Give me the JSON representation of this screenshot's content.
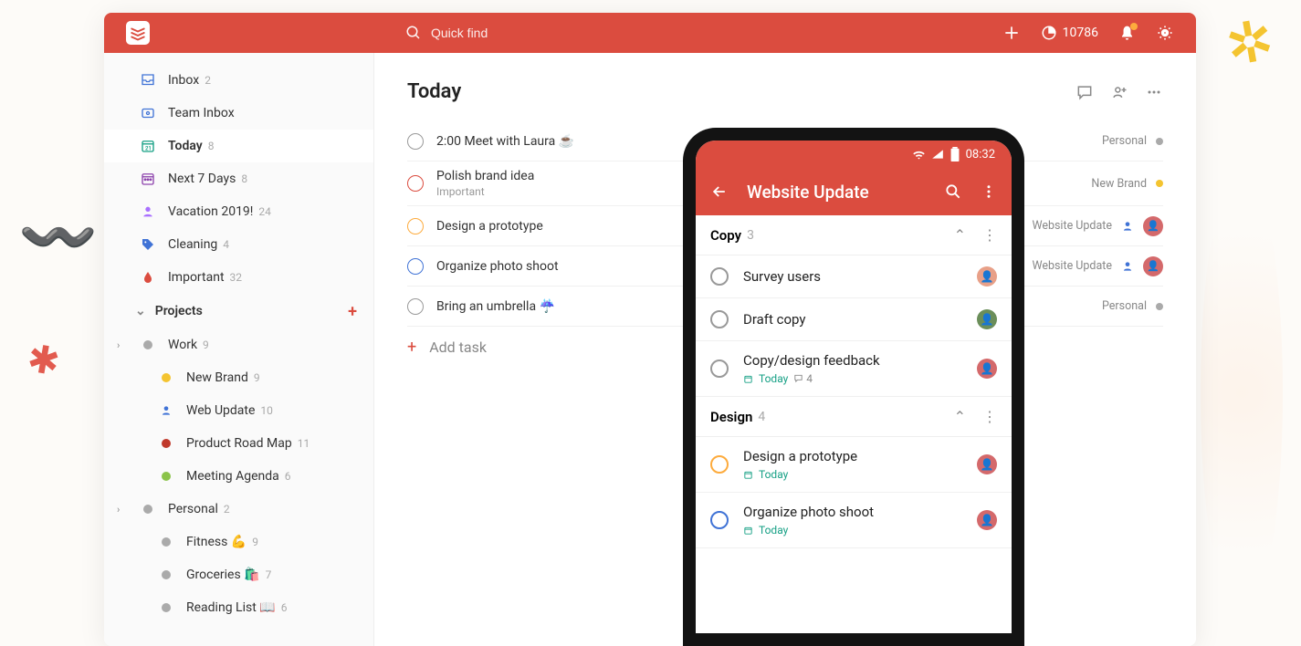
{
  "header": {
    "search_placeholder": "Quick find",
    "karma_count": "10786"
  },
  "sidebar": {
    "inbox": {
      "label": "Inbox",
      "count": "2"
    },
    "team_inbox": {
      "label": "Team Inbox"
    },
    "today": {
      "label": "Today",
      "count": "8"
    },
    "next7": {
      "label": "Next 7 Days",
      "count": "8"
    },
    "filters": [
      {
        "label": "Vacation 2019!",
        "count": "24",
        "color": "#a970ff",
        "icon": "person"
      },
      {
        "label": "Cleaning",
        "count": "4",
        "color": "#4073d6",
        "icon": "tag"
      },
      {
        "label": "Important",
        "count": "32",
        "color": "#db4c3f",
        "icon": "drop"
      }
    ],
    "projects_header": "Projects",
    "projects": [
      {
        "label": "Work",
        "count": "9",
        "color": "#aaa",
        "expandable": true,
        "children": [
          {
            "label": "New Brand",
            "count": "9",
            "color": "#f4c430"
          },
          {
            "label": "Web Update",
            "count": "10",
            "color": "#4073d6",
            "icon": "person"
          },
          {
            "label": "Product Road Map",
            "count": "11",
            "color": "#c0392b"
          },
          {
            "label": "Meeting Agenda",
            "count": "6",
            "color": "#8bc34a"
          }
        ]
      },
      {
        "label": "Personal",
        "count": "2",
        "color": "#aaa",
        "expandable": true,
        "children": [
          {
            "label": "Fitness 💪",
            "count": "9",
            "color": "#aaa"
          },
          {
            "label": "Groceries 🛍️",
            "count": "7",
            "color": "#aaa"
          },
          {
            "label": "Reading List 📖",
            "count": "6",
            "color": "#aaa"
          }
        ]
      }
    ]
  },
  "main": {
    "title": "Today",
    "tasks": [
      {
        "title": "2:00 Meet with Laura ☕",
        "priority": "none",
        "project": "Personal",
        "proj_color": "#aaa"
      },
      {
        "title": "Polish brand idea",
        "sub": "Important",
        "priority": "red",
        "project": "New Brand",
        "proj_color": "#f4c430"
      },
      {
        "title": "Design a prototype",
        "priority": "orange",
        "project": "Website Update",
        "proj_color": "",
        "avatar": true,
        "person_icon": true
      },
      {
        "title": "Organize photo shoot",
        "priority": "blue",
        "project": "Website Update",
        "proj_color": "",
        "avatar": true,
        "person_icon": true
      },
      {
        "title": "Bring an umbrella ☔",
        "priority": "none",
        "project": "Personal",
        "proj_color": "#aaa"
      }
    ],
    "add_task": "Add task"
  },
  "phone": {
    "time": "08:32",
    "title": "Website Update",
    "sections": [
      {
        "title": "Copy",
        "count": "3",
        "tasks": [
          {
            "title": "Survey users",
            "avatar_bg": "#e8a088"
          },
          {
            "title": "Draft copy",
            "avatar_bg": "#6b8e5a"
          },
          {
            "title": "Copy/design feedback",
            "meta_date": "Today",
            "comments": "4",
            "avatar_bg": "#d4696b"
          }
        ]
      },
      {
        "title": "Design",
        "count": "4",
        "tasks": [
          {
            "title": "Design a prototype",
            "priority": "orange",
            "meta_date": "Today",
            "avatar_bg": "#d4696b"
          },
          {
            "title": "Organize photo shoot",
            "priority": "blue",
            "meta_date": "Today",
            "avatar_bg": "#d4696b"
          }
        ]
      }
    ]
  }
}
